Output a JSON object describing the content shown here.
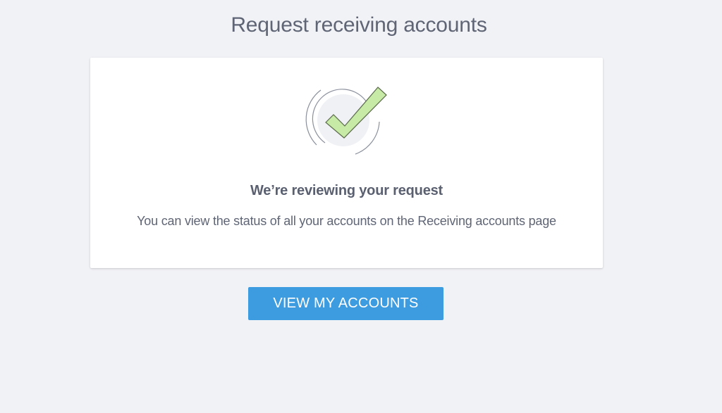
{
  "page": {
    "title": "Request receiving accounts"
  },
  "confirmation": {
    "icon": "check-circle-icon",
    "heading": "We’re reviewing your request",
    "message": "You can view the status of all your accounts on the Receiving accounts page"
  },
  "actions": {
    "view_accounts_label": "VIEW MY ACCOUNTS"
  },
  "colors": {
    "background": "#f1f2f6",
    "card": "#ffffff",
    "accent_button": "#3d9ce0",
    "check_fill": "#c7eaa6",
    "text": "#5f6575"
  }
}
